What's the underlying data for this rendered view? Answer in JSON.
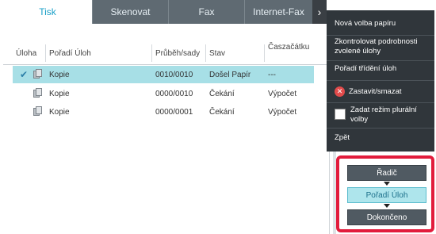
{
  "tabs": [
    {
      "label": "Tisk",
      "active": true
    },
    {
      "label": "Skenovat",
      "active": false
    },
    {
      "label": "Fax",
      "active": false
    },
    {
      "label": "Internet-Fax",
      "active": false
    }
  ],
  "table": {
    "headers": {
      "uloha": "Úloha",
      "poradi": "Pořadí Úloh",
      "prubeh": "Průběh/sady",
      "stav": "Stav",
      "cas_line1": "Čas",
      "cas_line2": "začátku"
    },
    "rows": [
      {
        "name": "Kopie",
        "progress": "0010/0010",
        "status": "Došel Papír",
        "time": "---",
        "selected": true
      },
      {
        "name": "Kopie",
        "progress": "0000/0010",
        "status": "Čekání",
        "time": "Výpočet",
        "selected": false
      },
      {
        "name": "Kopie",
        "progress": "0000/0001",
        "status": "Čekání",
        "time": "Výpočet",
        "selected": false
      }
    ]
  },
  "menu": {
    "new_paper": "Nová volba papíru",
    "check_details": "Zkontrolovat podrobnosti zvolené úlohy",
    "sort_order": "Pořadí třídění úloh",
    "stop_delete": "Zastavit/smazat",
    "plural_mode": "Zadat režim plurální volby",
    "back": "Zpět"
  },
  "sort_panel": {
    "driver": "Řadič",
    "job_order": "Pořadí Úloh",
    "completed": "Dokončeno"
  },
  "colors": {
    "accent": "#1aa0c8",
    "selected_row": "#a7dfe6",
    "menu_bg": "#30363b",
    "highlight_border": "#e21c3c"
  },
  "icons": {
    "tab_arrow": "chevron-right-icon",
    "row_check": "check-icon",
    "job": "copy-job-icon",
    "stop": "stop-x-icon"
  }
}
